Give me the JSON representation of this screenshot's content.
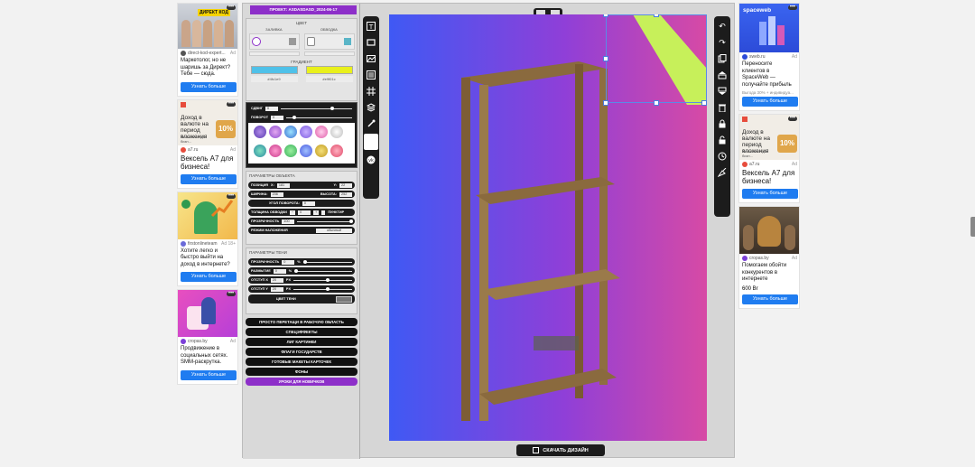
{
  "left_ads": [
    {
      "source": "direct-kod-expert...",
      "age": "Ad",
      "text": "Маркетолог, но не шаришь за Директ? Тебе — сюда.",
      "button": "Узнать больше",
      "image_label": "ДИРЕКТ КОД"
    },
    {
      "source": "a7.ru",
      "age": "Ad",
      "text": "Вексель А7 для бизнеса!",
      "button": "Узнать больше",
      "image_label": "Доход в валюте на период вложения",
      "image_sub": "Вексель А7 для бизн..."
    },
    {
      "source": "firstonlineteam",
      "age": "Ad 18+",
      "text": "Хотите легко и быстро выйти на доход в интернете?",
      "button": "Узнать больше"
    },
    {
      "source": "cropas.by",
      "age": "Ad",
      "text": "Продвижение в социальных сетях. SMM-раскрутка.",
      "button": "Узнать больше"
    }
  ],
  "right_ads": [
    {
      "source": "sweb.ru",
      "age": "Ad",
      "text": "Переносите клиентов в SpaceWeb — получайте прибыль",
      "sub": "Выгода 30% + индивидуа...",
      "button": "Узнать больше",
      "brand": "spaceweb"
    },
    {
      "source": "a7.ru",
      "age": "Ad",
      "text": "Вексель А7 для бизнеса!",
      "button": "Узнать больше",
      "image_label": "Доход в валюте на период вложения",
      "image_sub": "Вексель А7 для бизн..."
    },
    {
      "source": "cropas.by",
      "age": "Ad",
      "text": "Помогаем обойти конкурентов в интернете",
      "price": "600 Br",
      "button": "Узнать больше"
    }
  ],
  "project": {
    "label": "ПРОЕКТ:",
    "name": "ASDASDASD_2024-06-17"
  },
  "color_section": {
    "title": "ЦВЕТ",
    "fill_label": "ЗАЛИВКА",
    "stroke_label": "ОБВОДКА",
    "gradient_label": "ГРАДИЕНТ",
    "color1_hex": "#4fc1e9",
    "color2_hex": "#e9f01c",
    "color1_label": "#4fc1e9",
    "color2_label": "#e9f01c"
  },
  "shift_label": "СДВИГ",
  "shift_value": "0",
  "rotate_label": "ПОВОРОТ",
  "rotate_value": "0",
  "object_params": {
    "title": "ПАРАМЕТРЫ ОБЪЕКТА",
    "position_label": "ПОЗИЦИЯ",
    "x_label": "X:",
    "x_value": "181",
    "y_label": "Y:",
    "y_value": "22",
    "width_label": "ШИРИНА:",
    "width_value": "236",
    "height_label": "ВЫСОТА:",
    "height_value": "252",
    "angle_label": "УГОЛ ПОВОРОТА:",
    "angle_value": "0",
    "stroke_label": "ТОЛЩИНА ОБВОДКИ",
    "stroke_value": "0",
    "stroke_extra": "ПУНКТИР",
    "opacity_label": "ПРОЗРАЧНОСТЬ",
    "opacity_value": "100",
    "blend_label": "РЕЖИМ НАЛОЖЕНИЯ",
    "blend_value": "обычный"
  },
  "shadow_params": {
    "title": "ПАРАМЕТРЫ ТЕНИ",
    "opacity_label": "ПРОЗРАЧНОСТЬ",
    "opacity_value": "0",
    "opacity_unit": "%",
    "blur_label": "РАЗМЫТИЕ",
    "blur_value": "0",
    "blur_unit": "%",
    "offx_label": "ОТСТУП X",
    "offx_value": "20",
    "offx_unit": "PX",
    "offy_label": "ОТСТУП Y",
    "offy_value": "20",
    "offy_unit": "PX",
    "color_label": "ЦВЕТ ТЕНИ"
  },
  "action_buttons": [
    "ПРОСТО ПЕРЕТАЩИ В РАБОЧУЮ ОБЛАСТЬ",
    "СПЕЦЭФФЕКТЫ",
    "ЛИГ КАРТИНКИ",
    "ФЛАГИ ГОСУДАРСТВ",
    "ГОТОВЫЕ МАКЕТЫ КАРТОЧЕК",
    "ФОНЫ"
  ],
  "tutorial_button": "УРОКИ ДЛЯ НОВИЧКОВ",
  "download_button": "СКАЧАТЬ ДИЗАЙН",
  "left_tools": [
    "text-tool-icon",
    "rect-tool-icon",
    "image-tool-icon",
    "barcode-tool-icon",
    "grid-tool-icon",
    "layers-tool-icon",
    "eyedropper-tool-icon",
    "color-swatch-icon",
    "vk-icon"
  ],
  "right_tools": [
    "undo-icon",
    "redo-icon",
    "copy-icon",
    "layer-up-icon",
    "layer-down-icon",
    "delete-icon",
    "lock-icon",
    "unlock-icon",
    "history-icon",
    "clear-icon"
  ]
}
